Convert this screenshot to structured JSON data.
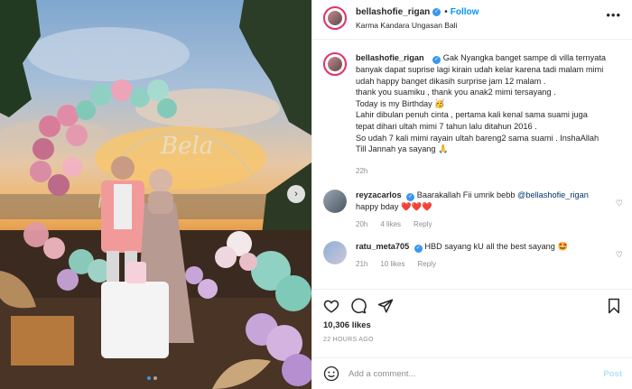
{
  "post": {
    "username": "bellashofie_rigan",
    "follow_label": "Follow",
    "separator": "•",
    "location": "Karma Kandara Ungasan Bali",
    "more_label": "•••",
    "photo_sign_text": "Bela",
    "caption_lines": [
      "Gak Nyangka banget sampe di villa ternyata",
      "banyak dapat suprise lagi kirain udah kelar karena tadi malam mimi",
      "udah happy banget dikasih surprise jam 12 malam .",
      "thank you suamiku , thank you anak2 mimi tersayang .",
      "Today is my Birthday 🥳",
      "Lahir dibulan penuh cinta , pertama kali kenal sama suami juga",
      "tepat dihari ultah mimi 7 tahun lalu ditahun 2016 .",
      "So udah 7 kali mimi rayain ultah bareng2 sama suami . InshaAllah",
      "Till Jannah ya sayang 🙏"
    ],
    "caption_time": "22h",
    "likes": "10,306 likes",
    "time_ago": "22 HOURS AGO",
    "add_comment_placeholder": "Add a comment...",
    "post_label": "Post"
  },
  "comments": [
    {
      "username": "reyzacarlos",
      "text_before": "Baarakallah Fii umrik bebb ",
      "mention": "@bellashofie_rigan",
      "line2": "happy bday ❤️❤️❤️",
      "time": "20h",
      "likes": "4 likes",
      "reply": "Reply"
    },
    {
      "username": "ratu_meta705",
      "text": "HBD sayang kU all the best sayang 🤩",
      "time": "21h",
      "likes": "10 likes",
      "reply": "Reply"
    }
  ],
  "colors": {
    "accent": "#0095f6",
    "verified": "#3897f0",
    "heart": "#ed4956",
    "muted": "#8e8e8e"
  },
  "icons": [
    "verified-icon",
    "more-icon",
    "heart-icon",
    "comment-icon",
    "share-icon",
    "bookmark-icon",
    "chevron-right-icon",
    "smile-icon"
  ]
}
